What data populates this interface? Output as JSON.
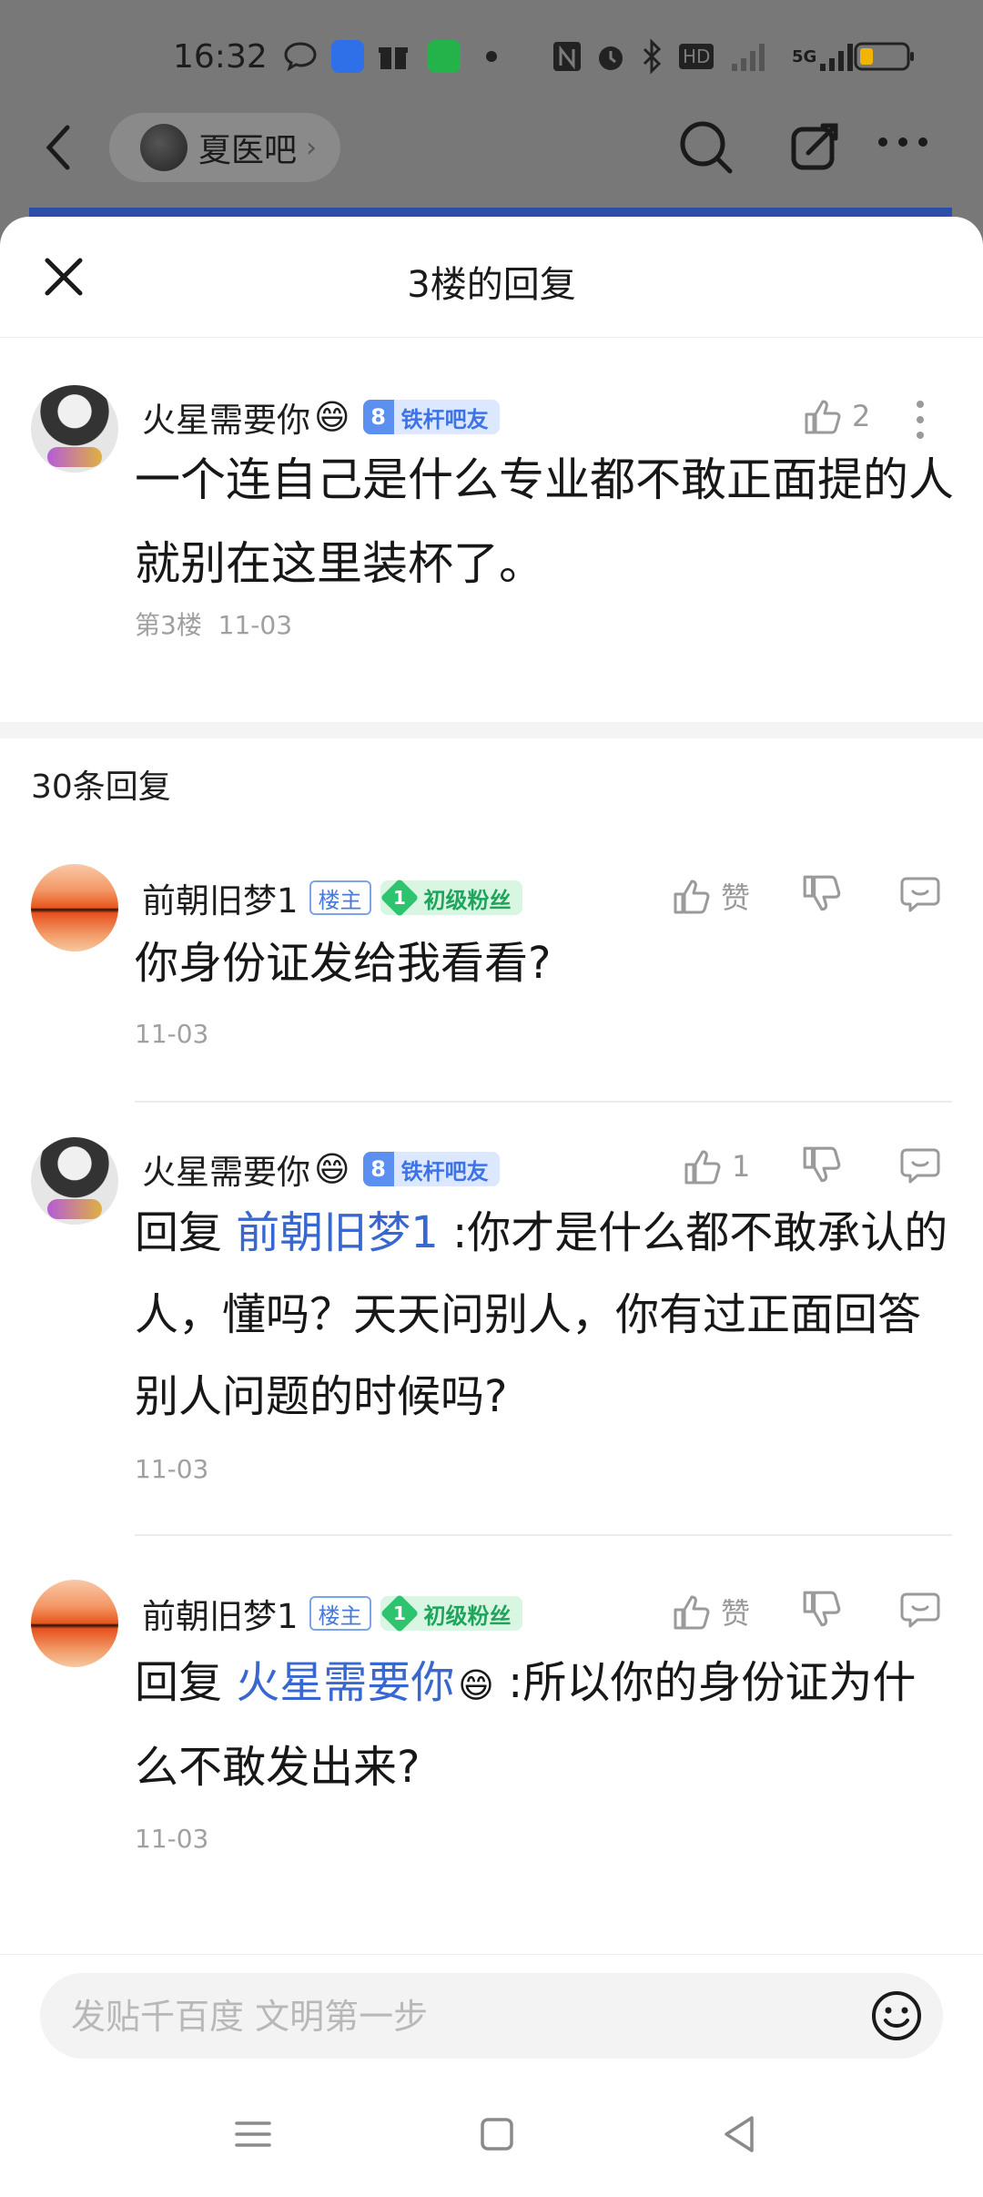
{
  "status_bar": {
    "time": "16:32",
    "network": "5G",
    "hd": "HD"
  },
  "background_header": {
    "forum_name": "夏医吧"
  },
  "sheet": {
    "title": "3楼的回复"
  },
  "main_post": {
    "username": "火星需要你",
    "emoji": "😄",
    "level": "8",
    "level_title": "铁杆吧友",
    "likes": "2",
    "text": "一个连自己是什么专业都不敢正面提的人就别在这里装杯了。",
    "floor": "第3楼",
    "date": "11-03"
  },
  "reply_count": "30条回复",
  "replies": [
    {
      "username": "前朝旧梦1",
      "owner_badge": "楼主",
      "fan_level": "1",
      "fan_title": "初级粉丝",
      "like_label": "赞",
      "text": "你身份证发给我看看?",
      "date": "11-03"
    },
    {
      "username": "火星需要你",
      "emoji": "😄",
      "level": "8",
      "level_title": "铁杆吧友",
      "like_count": "1",
      "reply_prefix": "回复 ",
      "reply_to": "前朝旧梦1",
      "text": " :你才是什么都不敢承认的人，懂吗？天天问别人，你有过正面回答别人问题的时候吗?",
      "date": "11-03"
    },
    {
      "username": "前朝旧梦1",
      "owner_badge": "楼主",
      "fan_level": "1",
      "fan_title": "初级粉丝",
      "like_label": "赞",
      "reply_prefix": "回复 ",
      "reply_to": "火星需要你",
      "reply_to_emoji": "😄",
      "text": " :所以你的身份证为什么不敢发出来?",
      "date": "11-03"
    }
  ],
  "input": {
    "placeholder": "发贴千百度 文明第一步"
  }
}
